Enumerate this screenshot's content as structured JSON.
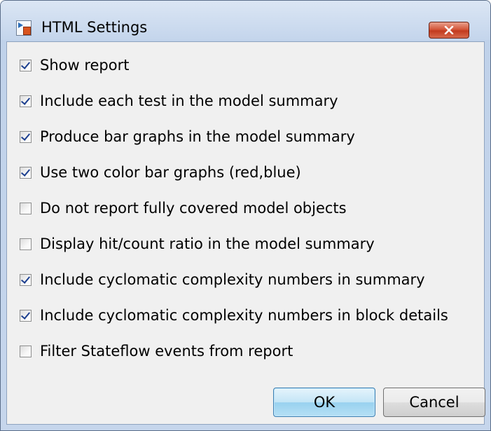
{
  "window": {
    "title": "HTML Settings",
    "app_icon": "report-app-icon",
    "close_icon": "close-x-icon",
    "close_color": "#c7472a"
  },
  "options": [
    {
      "label": "Show report",
      "checked": true
    },
    {
      "label": "Include each test in the model summary",
      "checked": true
    },
    {
      "label": "Produce bar graphs in the model summary",
      "checked": true
    },
    {
      "label": "Use two color bar graphs (red,blue)",
      "checked": true
    },
    {
      "label": "Do not report fully covered model objects",
      "checked": false
    },
    {
      "label": "Display hit/count ratio in the model summary",
      "checked": false
    },
    {
      "label": "Include cyclomatic complexity numbers in summary",
      "checked": true
    },
    {
      "label": "Include cyclomatic complexity numbers in block details",
      "checked": true
    },
    {
      "label": "Filter Stateflow events from report",
      "checked": false
    }
  ],
  "buttons": {
    "ok_label": "OK",
    "cancel_label": "Cancel"
  }
}
